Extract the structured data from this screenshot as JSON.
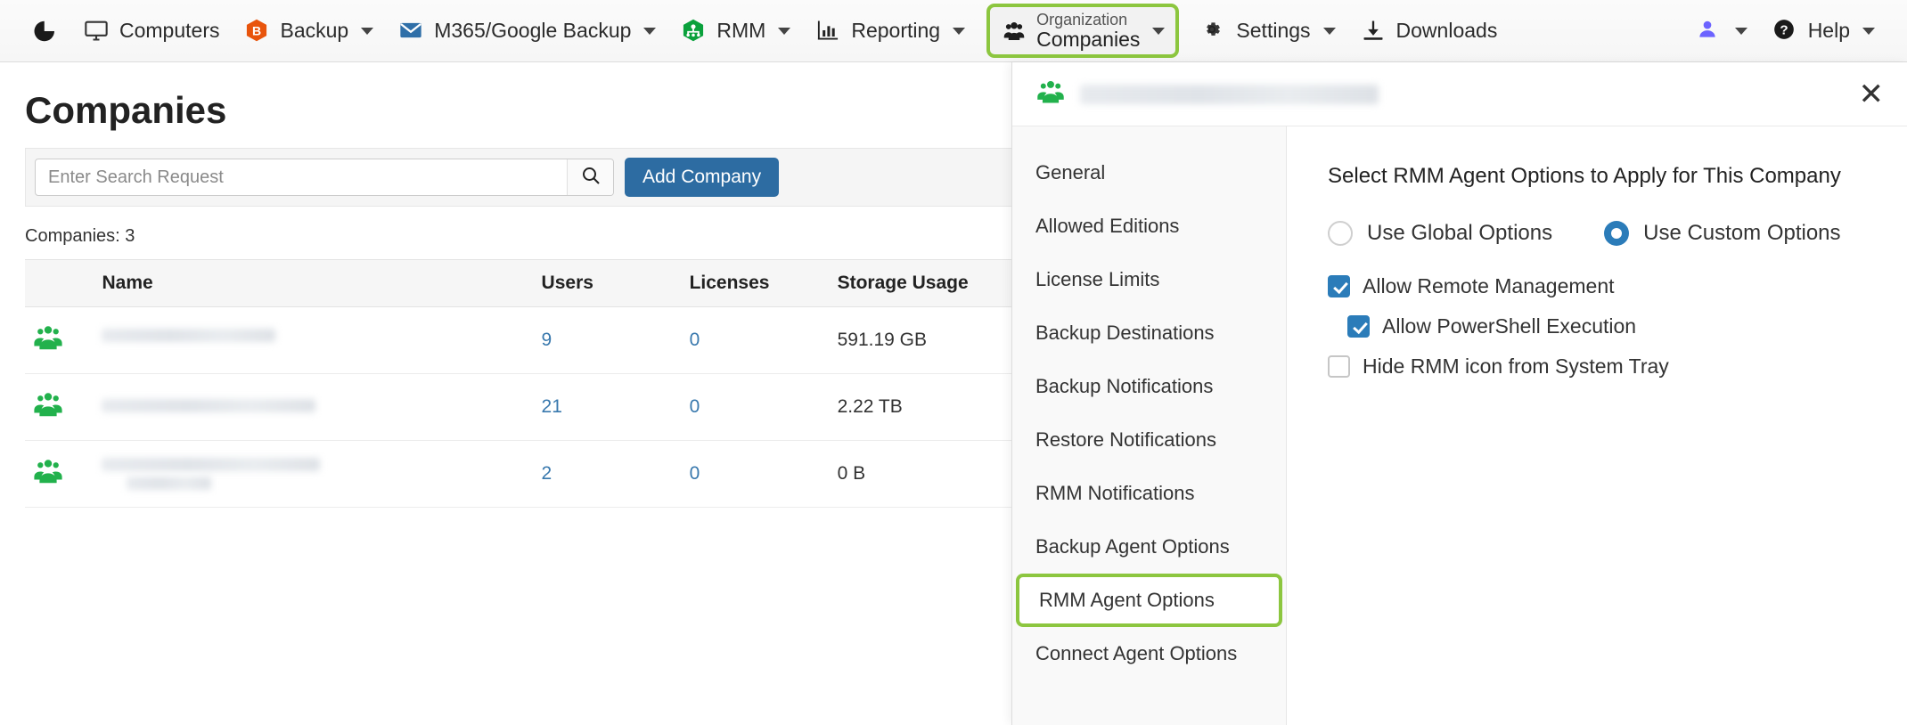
{
  "topnav": {
    "logo_icon": "pie-chart-icon",
    "items": [
      {
        "label": "Computers",
        "icon": "monitor-icon",
        "caret": false
      },
      {
        "label": "Backup",
        "icon": "backup-hexagon-icon",
        "caret": true
      },
      {
        "label": "M365/Google Backup",
        "icon": "envelope-icon",
        "caret": true
      },
      {
        "label": "RMM",
        "icon": "rmm-hexagon-icon",
        "caret": true
      },
      {
        "label": "Reporting",
        "icon": "bar-chart-icon",
        "caret": true
      },
      {
        "label": "Settings",
        "icon": "gear-icon",
        "caret": true
      },
      {
        "label": "Downloads",
        "icon": "download-icon",
        "caret": false
      }
    ],
    "organization": {
      "small_label": "Organization",
      "big_label": "Companies",
      "icon": "group-icon",
      "highlight_color": "#8cc63f"
    },
    "user_menu": {
      "icon": "user-icon",
      "color": "#6c63ff"
    },
    "help": {
      "label": "Help",
      "icon": "question-circle-icon"
    }
  },
  "main": {
    "title": "Companies",
    "search": {
      "placeholder": "Enter Search Request",
      "value": "",
      "icon": "search-icon"
    },
    "add_button": "Add Company",
    "count_label": "Companies: 3",
    "table": {
      "columns": [
        "Name",
        "Users",
        "Licenses",
        "Storage Usage"
      ],
      "rows": [
        {
          "icon": "group-icon",
          "name": "",
          "users": "9",
          "licenses": "0",
          "storage": "591.19 GB"
        },
        {
          "icon": "group-icon",
          "name": "",
          "users": "21",
          "licenses": "0",
          "storage": "2.22 TB"
        },
        {
          "icon": "group-icon",
          "name": "",
          "users": "2",
          "licenses": "0",
          "storage": "0 B"
        }
      ]
    }
  },
  "panel": {
    "header": {
      "icon": "group-icon",
      "title": "",
      "close_icon": "close-icon"
    },
    "menu": [
      {
        "label": "General",
        "active": false
      },
      {
        "label": "Allowed Editions",
        "active": false
      },
      {
        "label": "License Limits",
        "active": false
      },
      {
        "label": "Backup Destinations",
        "active": false
      },
      {
        "label": "Backup Notifications",
        "active": false
      },
      {
        "label": "Restore Notifications",
        "active": false
      },
      {
        "label": "RMM Notifications",
        "active": false
      },
      {
        "label": "Backup Agent Options",
        "active": false
      },
      {
        "label": "RMM Agent Options",
        "active": true
      },
      {
        "label": "Connect Agent Options",
        "active": false
      }
    ],
    "content": {
      "title": "Select RMM Agent Options to Apply for This Company",
      "radios": [
        {
          "label": "Use Global Options",
          "checked": false
        },
        {
          "label": "Use Custom Options",
          "checked": true
        }
      ],
      "checkboxes": [
        {
          "label": "Allow Remote Management",
          "checked": true,
          "indent": false
        },
        {
          "label": "Allow PowerShell Execution",
          "checked": true,
          "indent": true
        },
        {
          "label": "Hide RMM icon from System Tray",
          "checked": false,
          "indent": false
        }
      ]
    }
  },
  "colors": {
    "accent_green": "#8cc63f",
    "primary_blue": "#2d6ca2",
    "checkbox_blue": "#2b7cb9",
    "link_blue": "#3878ad",
    "icon_green": "#22b14c",
    "backup_orange": "#e8540c"
  }
}
